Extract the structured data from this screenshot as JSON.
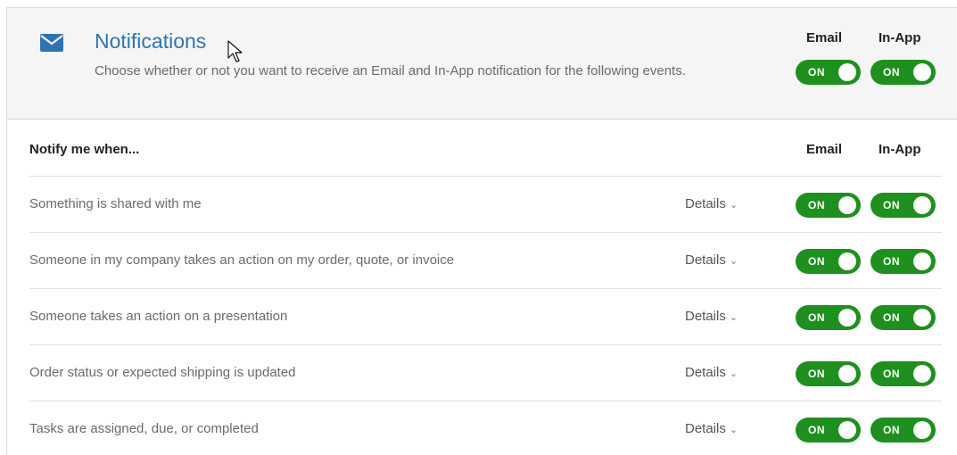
{
  "header": {
    "title": "Notifications",
    "description": "Choose whether or not you want to receive an Email and In-App notification for the following events.",
    "email_label": "Email",
    "inapp_label": "In-App",
    "email_toggle": "ON",
    "inapp_toggle": "ON"
  },
  "table": {
    "heading": "Notify me when...",
    "email_label": "Email",
    "inapp_label": "In-App",
    "rows": [
      {
        "text": "Something is shared with me",
        "details": "Details",
        "email": "ON",
        "inapp": "ON"
      },
      {
        "text": "Someone in my company takes an action on my order, quote, or invoice",
        "details": "Details",
        "email": "ON",
        "inapp": "ON"
      },
      {
        "text": "Someone takes an action on a presentation",
        "details": "Details",
        "email": "ON",
        "inapp": "ON"
      },
      {
        "text": "Order status or expected shipping is updated",
        "details": "Details",
        "email": "ON",
        "inapp": "ON"
      },
      {
        "text": "Tasks are assigned, due, or completed",
        "details": "Details",
        "email": "ON",
        "inapp": "ON"
      }
    ]
  },
  "icons": {
    "mail": "mail-icon",
    "chevron": "chevron-down-icon",
    "cursor": "cursor-icon"
  },
  "colors": {
    "toggle_on": "#1f8f1f",
    "title": "#2f73b3",
    "header_bg": "#f5f5f5"
  }
}
